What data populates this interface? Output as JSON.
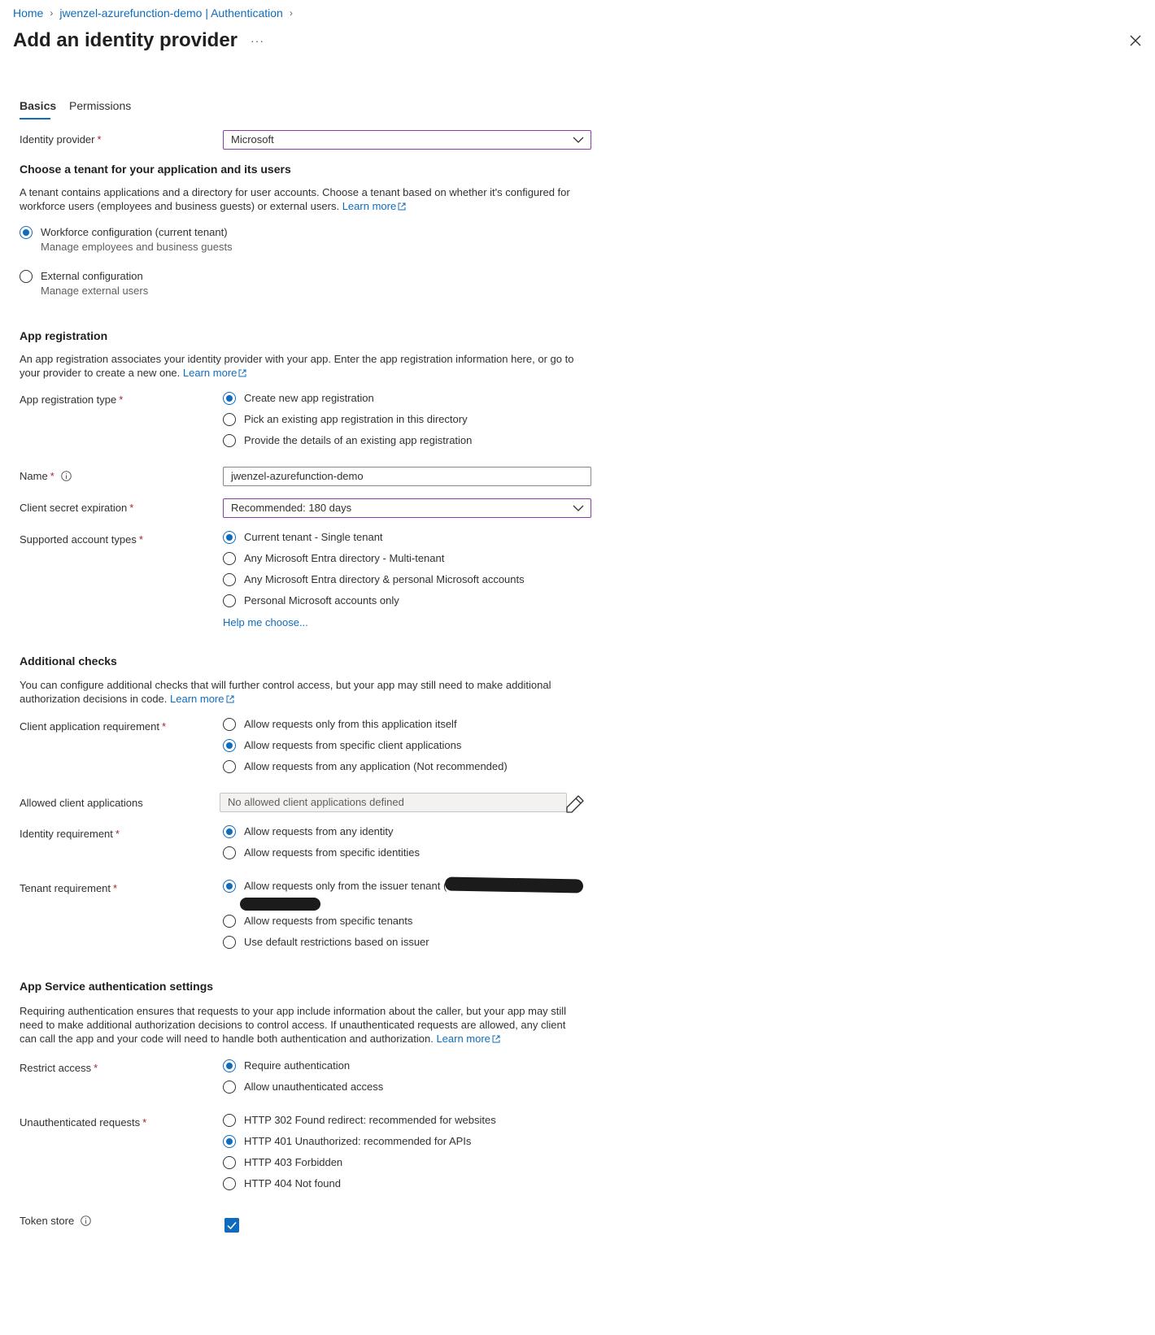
{
  "breadcrumb": {
    "home": "Home",
    "resource": "jwenzel-azurefunction-demo | Authentication"
  },
  "header": {
    "title": "Add an identity provider",
    "more": "···"
  },
  "tabs": [
    {
      "label": "Basics"
    },
    {
      "label": "Permissions"
    }
  ],
  "identity_provider": {
    "label": "Identity provider",
    "value": "Microsoft"
  },
  "tenant_section": {
    "title": "Choose a tenant for your application and its users",
    "description": "A tenant contains applications and a directory for user accounts. Choose a tenant based on whether it's configured for workforce users (employees and business guests) or external users.",
    "learn_more": "Learn more",
    "options": [
      {
        "label": "Workforce configuration (current tenant)",
        "sub": "Manage employees and business guests",
        "checked": true
      },
      {
        "label": "External configuration",
        "sub": "Manage external users",
        "checked": false
      }
    ]
  },
  "app_registration": {
    "title": "App registration",
    "description": "An app registration associates your identity provider with your app. Enter the app registration information here, or go to your provider to create a new one.",
    "learn_more": "Learn more",
    "type_label": "App registration type",
    "type_options": [
      {
        "label": "Create new app registration",
        "checked": true
      },
      {
        "label": "Pick an existing app registration in this directory",
        "checked": false
      },
      {
        "label": "Provide the details of an existing app registration",
        "checked": false
      }
    ],
    "name_label": "Name",
    "name_value": "jwenzel-azurefunction-demo",
    "secret_label": "Client secret expiration",
    "secret_value": "Recommended: 180 days",
    "account_types_label": "Supported account types",
    "account_types": [
      {
        "label": "Current tenant - Single tenant",
        "checked": true
      },
      {
        "label": "Any Microsoft Entra directory - Multi-tenant",
        "checked": false
      },
      {
        "label": "Any Microsoft Entra directory & personal Microsoft accounts",
        "checked": false
      },
      {
        "label": "Personal Microsoft accounts only",
        "checked": false
      }
    ],
    "help_link": "Help me choose..."
  },
  "additional_checks": {
    "title": "Additional checks",
    "description": "You can configure additional checks that will further control access, but your app may still need to make additional authorization decisions in code.",
    "learn_more": "Learn more",
    "client_app_label": "Client application requirement",
    "client_app_options": [
      {
        "label": "Allow requests only from this application itself",
        "checked": false
      },
      {
        "label": "Allow requests from specific client applications",
        "checked": true
      },
      {
        "label": "Allow requests from any application (Not recommended)",
        "checked": false
      }
    ],
    "allowed_clients_label": "Allowed client applications",
    "allowed_clients_placeholder": "No allowed client applications defined",
    "identity_label": "Identity requirement",
    "identity_options": [
      {
        "label": "Allow requests from any identity",
        "checked": true
      },
      {
        "label": "Allow requests from specific identities",
        "checked": false
      }
    ],
    "tenant_label": "Tenant requirement",
    "tenant_options": [
      {
        "label": "Allow requests only from the issuer tenant (",
        "checked": true
      },
      {
        "label": "Allow requests from specific tenants",
        "checked": false
      },
      {
        "label": "Use default restrictions based on issuer",
        "checked": false
      }
    ]
  },
  "app_service": {
    "title": "App Service authentication settings",
    "description": "Requiring authentication ensures that requests to your app include information about the caller, but your app may still need to make additional authorization decisions to control access. If unauthenticated requests are allowed, any client can call the app and your code will need to handle both authentication and authorization.",
    "learn_more": "Learn more",
    "restrict_label": "Restrict access",
    "restrict_options": [
      {
        "label": "Require authentication",
        "checked": true
      },
      {
        "label": "Allow unauthenticated access",
        "checked": false
      }
    ],
    "unauth_label": "Unauthenticated requests",
    "unauth_options": [
      {
        "label": "HTTP 302 Found redirect: recommended for websites",
        "checked": false
      },
      {
        "label": "HTTP 401 Unauthorized: recommended for APIs",
        "checked": true
      },
      {
        "label": "HTTP 403 Forbidden",
        "checked": false
      },
      {
        "label": "HTTP 404 Not found",
        "checked": false
      }
    ],
    "token_store_label": "Token store",
    "token_store_checked": true
  },
  "required_mark": "*",
  "colors": {
    "accent": "#0f6cbd",
    "focus_border": "#8a3ca8",
    "required": "#a4262c"
  }
}
